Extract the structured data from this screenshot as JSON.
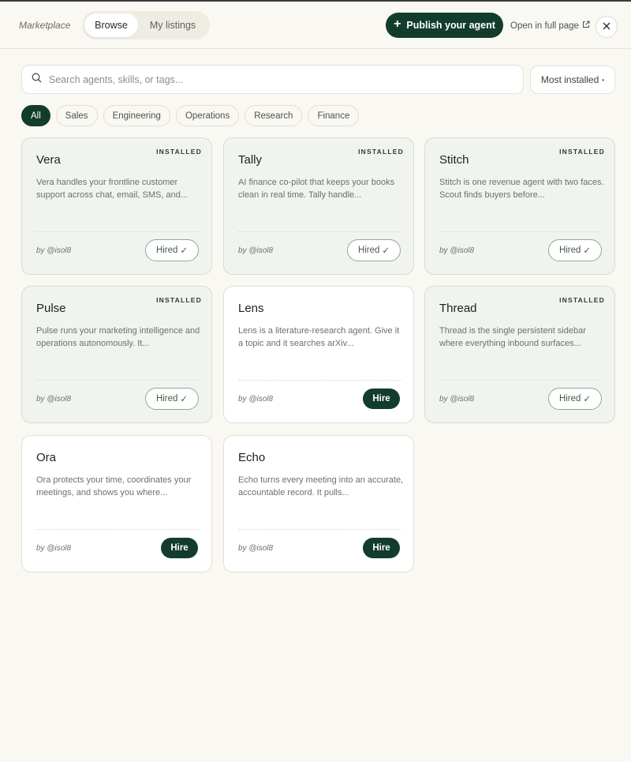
{
  "header": {
    "brand": "Marketplace",
    "tabs": [
      {
        "label": "Browse",
        "active": true
      },
      {
        "label": "My listings",
        "active": false
      }
    ],
    "publish_label": "Publish your agent",
    "open_full_label": "Open in full page"
  },
  "search": {
    "placeholder": "Search agents, skills, or tags...",
    "value": ""
  },
  "sort": {
    "selected": "Most installed",
    "caret": "•"
  },
  "filters": [
    "All",
    "Sales",
    "Engineering",
    "Operations",
    "Research",
    "Finance"
  ],
  "active_filter": "All",
  "agents": [
    {
      "name": "Vera",
      "installed": true,
      "badge": "INSTALLED",
      "desc": "Vera handles your frontline customer support across chat, email, SMS, and...",
      "author": "by @isol8",
      "action": "Hired"
    },
    {
      "name": "Tally",
      "installed": true,
      "badge": "INSTALLED",
      "desc": "AI finance co-pilot that keeps your books clean in real time. Tally handle...",
      "author": "by @isol8",
      "action": "Hired"
    },
    {
      "name": "Stitch",
      "installed": true,
      "badge": "INSTALLED",
      "desc": "Stitch is one revenue agent with two faces. Scout finds buyers before...",
      "author": "by @isol8",
      "action": "Hired"
    },
    {
      "name": "Pulse",
      "installed": true,
      "badge": "INSTALLED",
      "desc": "Pulse runs your marketing intelligence and operations autonomously. It...",
      "author": "by @isol8",
      "action": "Hired"
    },
    {
      "name": "Lens",
      "installed": false,
      "badge": "",
      "desc": "Lens is a literature-research agent. Give it a topic and it searches arXiv...",
      "author": "by @isol8",
      "action": "Hire"
    },
    {
      "name": "Thread",
      "installed": true,
      "badge": "INSTALLED",
      "desc": "Thread is the single persistent sidebar where everything inbound surfaces...",
      "author": "by @isol8",
      "action": "Hired"
    },
    {
      "name": "Ora",
      "installed": false,
      "badge": "",
      "desc": "Ora protects your time, coordinates your meetings, and shows you where...",
      "author": "by @isol8",
      "action": "Hire"
    },
    {
      "name": "Echo",
      "installed": false,
      "badge": "",
      "desc": "Echo turns every meeting into an accurate, accountable record. It pulls...",
      "author": "by @isol8",
      "action": "Hire"
    }
  ],
  "colors": {
    "accent": "#123d2c",
    "background": "#faf8f3",
    "installed_card": "#f1f4ee"
  }
}
